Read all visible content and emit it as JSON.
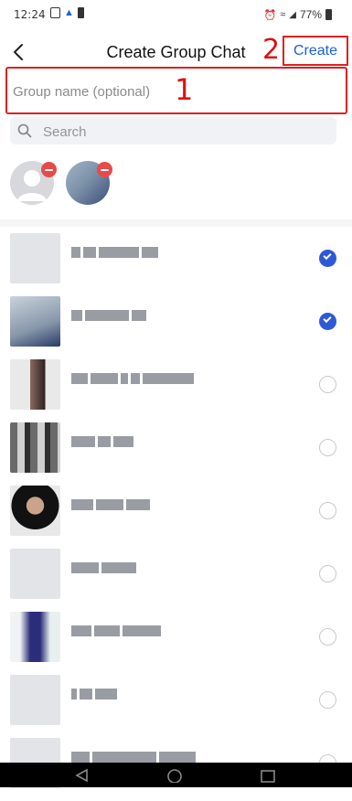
{
  "status_bar": {
    "time": "12:24",
    "battery": "77%",
    "left_icons": [
      "gallery-icon",
      "app-icon",
      "battery-saver-icon"
    ],
    "right_icons": [
      "alarm-icon",
      "wifi-icon",
      "signal-icon",
      "battery-icon"
    ]
  },
  "header": {
    "back_icon": "chevron-left-icon",
    "title": "Create Group Chat",
    "create_label": "Create",
    "annotation_2": "2"
  },
  "group_name": {
    "placeholder": "Group name (optional)",
    "value": "",
    "annotation_1": "1"
  },
  "search": {
    "placeholder": "Search",
    "icon": "search-icon"
  },
  "selected_members": [
    {
      "avatar": "default-avatar",
      "remove_icon": "remove-icon"
    },
    {
      "avatar": "photo-avatar",
      "remove_icon": "remove-icon"
    }
  ],
  "contacts": [
    {
      "selected": true
    },
    {
      "selected": true
    },
    {
      "selected": false
    },
    {
      "selected": false
    },
    {
      "selected": false
    },
    {
      "selected": false
    },
    {
      "selected": false
    },
    {
      "selected": false
    },
    {
      "selected": false
    }
  ],
  "colors": {
    "accent": "#2c59d6",
    "create_text": "#1a5fd6",
    "annotation_red": "#e01010",
    "remove_badge": "#e84a4a"
  },
  "system_nav": [
    "back-icon",
    "home-icon",
    "recents-icon"
  ]
}
